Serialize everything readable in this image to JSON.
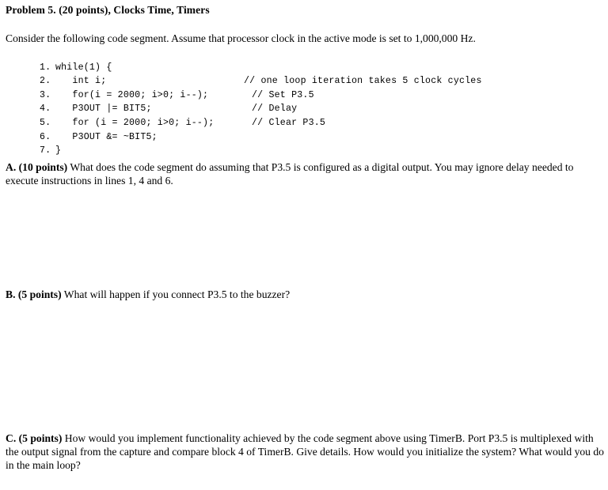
{
  "document": {
    "title": "Problem 5. (20 points), Clocks Time, Timers",
    "intro": "Consider the following code segment. Assume that processor clock in the active mode is set to 1,000,000 Hz."
  },
  "code": {
    "lines": [
      {
        "number": "1.",
        "text": "while(1) {",
        "comment": ""
      },
      {
        "number": "2.",
        "text": "   int i;",
        "comment": ""
      },
      {
        "number": "3.",
        "text": "   for(i = 2000; i>0; i--);",
        "comment": "// one loop iteration takes 5 clock cycles"
      },
      {
        "number": "4.",
        "text": "   P3OUT |= BIT5;",
        "comment": "// Set P3.5"
      },
      {
        "number": "5.",
        "text": "   for (i = 2000; i>0; i--);",
        "comment": "// Delay"
      },
      {
        "number": "6.",
        "text": "   P3OUT &= ~BIT5;",
        "comment": "// Clear P3.5"
      },
      {
        "number": "7.",
        "text": "}",
        "comment": ""
      }
    ]
  },
  "questions": [
    {
      "label": "A. (10 points)",
      "body": " What does the code segment do assuming that P3.5 is configured as a digital output. You may ignore delay needed to execute instructions in lines 1, 4 and 6."
    },
    {
      "label": "B. (5 points)",
      "body": " What will happen if you connect P3.5 to the buzzer?"
    },
    {
      "label": "C. (5 points)",
      "body": " How would you implement functionality achieved by the code segment above using TimerB. Port P3.5 is multiplexed with the output signal from the capture and compare block 4 of TimerB. Give details. How would you initialize the system? What would you do in the main loop?"
    }
  ]
}
